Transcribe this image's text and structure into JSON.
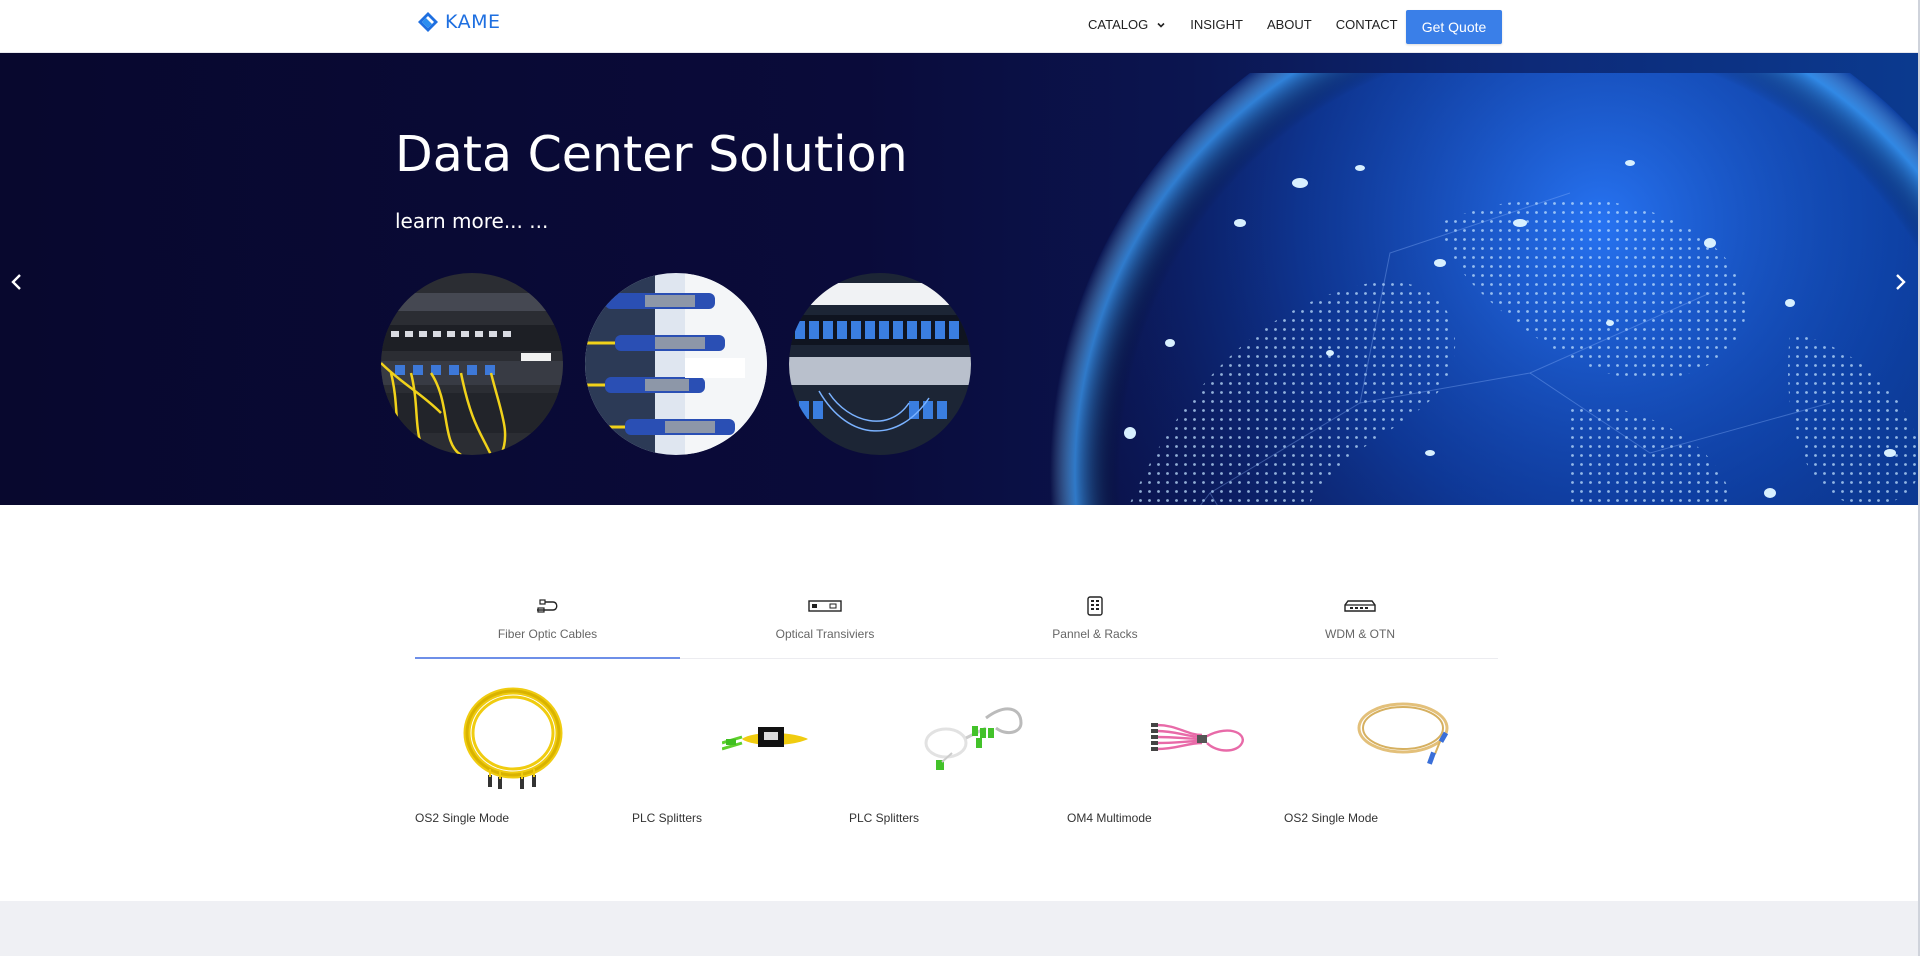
{
  "brand": {
    "name": "KAME",
    "color": "#1e6fe0"
  },
  "nav": {
    "items": [
      {
        "label": "CATALOG",
        "has_dropdown": true
      },
      {
        "label": "INSIGHT"
      },
      {
        "label": "ABOUT"
      },
      {
        "label": "CONTACT"
      }
    ],
    "cta_label": "Get Quote",
    "cta_color": "#3a7fe8"
  },
  "hero": {
    "title": "Data Center Solution",
    "subtitle": "learn more... ...",
    "prev_icon": "chevron-left-icon",
    "next_icon": "chevron-right-icon"
  },
  "tabs": [
    {
      "label": "Fiber Optic Cables",
      "icon": "cable-icon",
      "active": true
    },
    {
      "label": "Optical Transiviers",
      "icon": "transceiver-icon",
      "active": false
    },
    {
      "label": "Pannel & Racks",
      "icon": "rack-icon",
      "active": false
    },
    {
      "label": "WDM & OTN",
      "icon": "wdm-device-icon",
      "active": false
    }
  ],
  "products": [
    {
      "name": "OS2 Single Mode"
    },
    {
      "name": "PLC Splitters"
    },
    {
      "name": "PLC Splitters"
    },
    {
      "name": "OM4 Multimode"
    },
    {
      "name": "OS2 Single Mode"
    }
  ]
}
